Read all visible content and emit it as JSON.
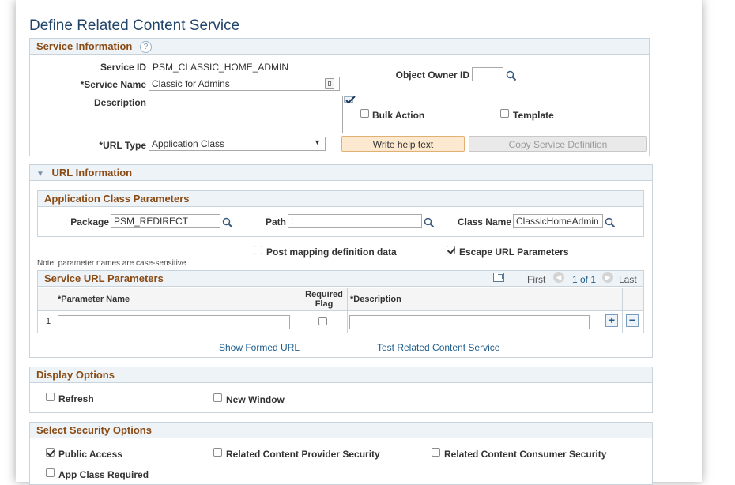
{
  "page": {
    "title": "Define Related Content Service"
  },
  "service_info": {
    "header": "Service Information",
    "service_id_label": "Service ID",
    "service_id_value": "PSM_CLASSIC_HOME_ADMIN",
    "service_name_label": "*Service Name",
    "service_name_value": "Classic for Admins",
    "description_label": "Description",
    "description_value": "",
    "object_owner_label": "Object Owner ID",
    "object_owner_value": "",
    "bulk_action_label": "Bulk Action",
    "bulk_action_checked": false,
    "template_label": "Template",
    "template_checked": false,
    "url_type_label": "*URL Type",
    "url_type_value": "Application Class",
    "write_help_label": "Write help text",
    "copy_service_label": "Copy Service Definition"
  },
  "url_info": {
    "header": "URL Information",
    "app_class_header": "Application Class Parameters",
    "package_label": "Package",
    "package_value": "PSM_REDIRECT",
    "path_label": "Path",
    "path_value": ":",
    "class_name_label": "Class Name",
    "class_name_value": "ClassicHomeAdmin",
    "post_mapping_label": "Post mapping definition data",
    "post_mapping_checked": false,
    "escape_url_label": "Escape URL Parameters",
    "escape_url_checked": true,
    "note": "Note: parameter names are case-sensitive.",
    "params_header": "Service URL Parameters",
    "nav_first": "First",
    "nav_count": "1 of 1",
    "nav_last": "Last",
    "columns": {
      "param_name": "*Parameter Name",
      "required_flag": "Required Flag",
      "description": "*Description"
    },
    "rows": [
      {
        "num": "1",
        "param_name": "",
        "required": false,
        "description": ""
      }
    ],
    "show_formed_url": "Show Formed URL",
    "test_service": "Test Related Content Service"
  },
  "display_options": {
    "header": "Display Options",
    "refresh_label": "Refresh",
    "refresh_checked": false,
    "new_window_label": "New Window",
    "new_window_checked": false
  },
  "security": {
    "header": "Select Security Options",
    "public_access_label": "Public Access",
    "public_access_checked": true,
    "provider_security_label": "Related Content Provider Security",
    "provider_security_checked": false,
    "consumer_security_label": "Related Content Consumer Security",
    "consumer_security_checked": false,
    "app_class_required_label": "App Class Required",
    "app_class_required_checked": false
  },
  "colors": {
    "group_header_text": "#8a4b14",
    "title": "#22456a",
    "link": "#1e5d8c",
    "orange_button": "#fde9cf"
  }
}
